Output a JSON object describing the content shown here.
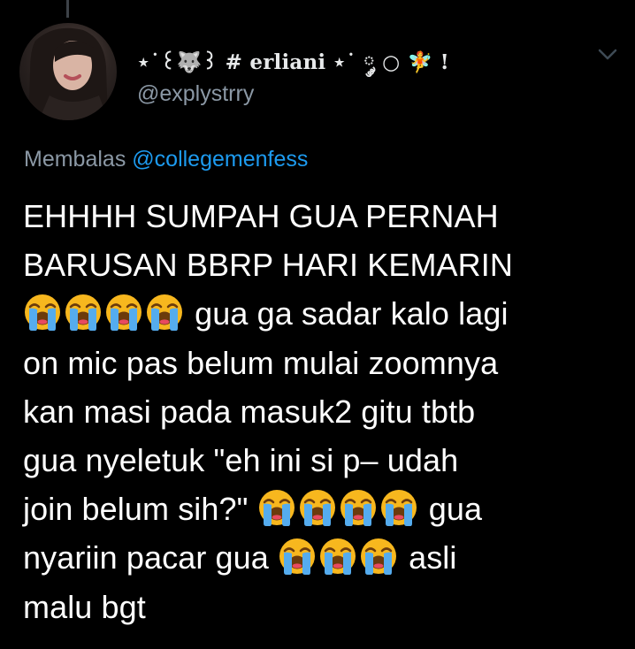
{
  "tweet": {
    "display_name": "⋆˙꒰🐺꒱ # erliani ⋆˙ ༘ ○ 🧚 !",
    "handle": "@explystrry",
    "reply_prefix": "Membalas",
    "reply_to": "@collegemenfess",
    "lines": [
      "EHHHH SUMPAH GUA PERNAH",
      "BARUSAN BBRP HARI KEMARIN",
      " gua ga sadar kalo lagi",
      "on mic pas belum mulai zoomnya",
      "kan masi pada masuk2 gitu tbtb",
      "gua nyeletuk \"eh ini si p– udah",
      "join belum sih?\" ",
      " gua",
      "nyariin pacar gua ",
      " asli",
      "malu bgt"
    ],
    "emoji_name": "loudly-crying-face-icon"
  },
  "colors": {
    "background": "#000000",
    "text": "#ffffff",
    "muted": "#8b98a5",
    "link": "#1d9bf0"
  }
}
